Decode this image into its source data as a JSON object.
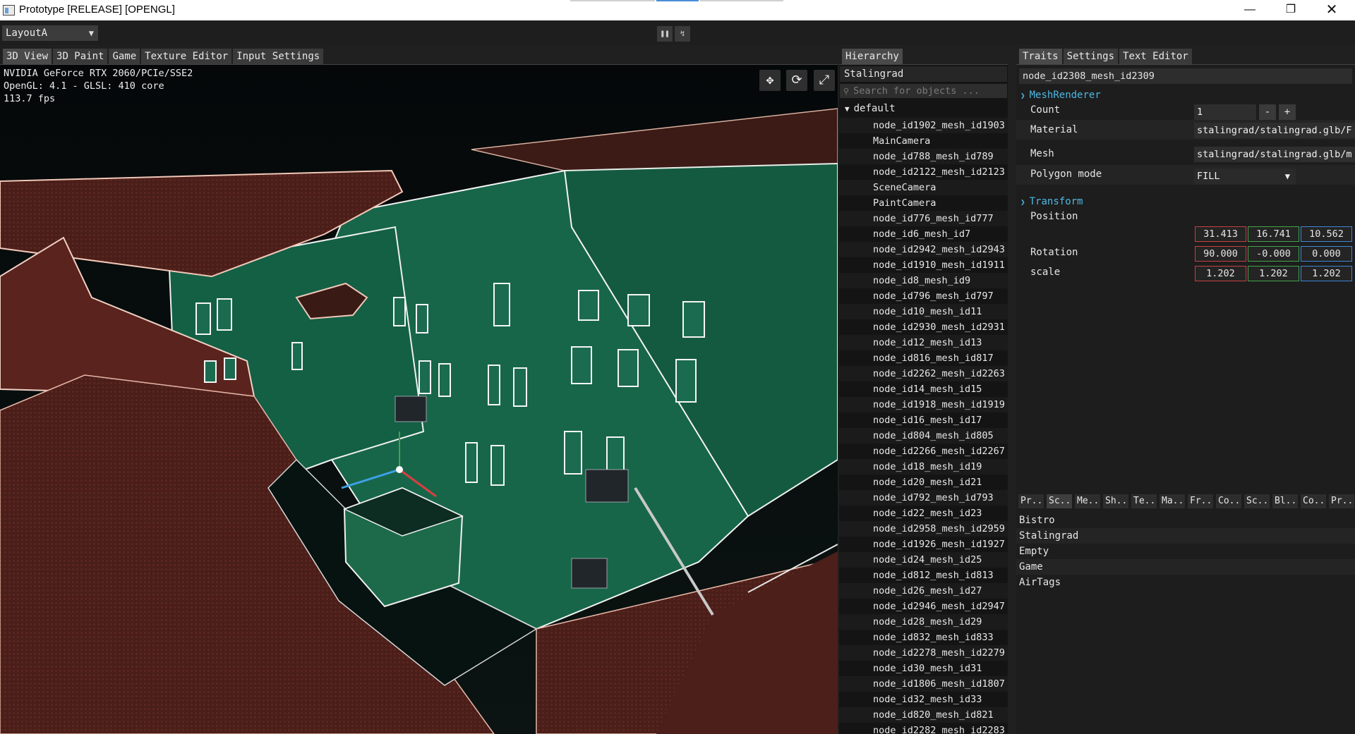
{
  "window": {
    "title": "Prototype [RELEASE] [OPENGL]",
    "minimize_icon": "minimize-icon",
    "maximize_icon": "restore-icon",
    "close_icon": "close-icon"
  },
  "toolbar": {
    "layout_value": "LayoutA",
    "pause_icon": "pause-icon",
    "step_icon": "step-icon"
  },
  "viewport_tabs": [
    "3D View",
    "3D Paint",
    "Game",
    "Texture Editor",
    "Input Settings"
  ],
  "viewport": {
    "gpu": "NVIDIA GeForce RTX 2060/PCIe/SSE2",
    "opengl": "OpenGL: 4.1 - GLSL: 410 core",
    "fps": "113.7 fps",
    "buttons": [
      "move-icon",
      "rotate-icon",
      "scale-icon"
    ]
  },
  "hierarchy": {
    "tab": "Hierarchy",
    "scene_name": "Stalingrad",
    "search_placeholder": "Search for objects ...",
    "group": "default",
    "items": [
      "node_id1902_mesh_id1903",
      "MainCamera",
      "node_id788_mesh_id789",
      "node_id2122_mesh_id2123",
      "SceneCamera",
      "PaintCamera",
      "node_id776_mesh_id777",
      "node_id6_mesh_id7",
      "node_id2942_mesh_id2943",
      "node_id1910_mesh_id1911",
      "node_id8_mesh_id9",
      "node_id796_mesh_id797",
      "node_id10_mesh_id11",
      "node_id2930_mesh_id2931",
      "node_id12_mesh_id13",
      "node_id816_mesh_id817",
      "node_id2262_mesh_id2263",
      "node_id14_mesh_id15",
      "node_id1918_mesh_id1919",
      "node_id16_mesh_id17",
      "node_id804_mesh_id805",
      "node_id2266_mesh_id2267",
      "node_id18_mesh_id19",
      "node_id20_mesh_id21",
      "node_id792_mesh_id793",
      "node_id22_mesh_id23",
      "node_id2958_mesh_id2959",
      "node_id1926_mesh_id1927",
      "node_id24_mesh_id25",
      "node_id812_mesh_id813",
      "node_id26_mesh_id27",
      "node_id2946_mesh_id2947",
      "node_id28_mesh_id29",
      "node_id832_mesh_id833",
      "node_id2278_mesh_id2279",
      "node_id30_mesh_id31",
      "node_id1806_mesh_id1807",
      "node_id32_mesh_id33",
      "node_id820_mesh_id821",
      "node_id2282_mesh_id2283"
    ]
  },
  "inspector": {
    "tabs": [
      "Traits",
      "Settings",
      "Text Editor"
    ],
    "node_name": "node_id2308_mesh_id2309",
    "mesh_renderer": {
      "title": "MeshRenderer",
      "count_label": "Count",
      "count_value": "1",
      "minus": "-",
      "plus": "+",
      "material_label": "Material",
      "material_value": "stalingrad/stalingrad.glb/F",
      "mesh_label": "Mesh",
      "mesh_value": "stalingrad/stalingrad.glb/m",
      "polygon_label": "Polygon mode",
      "polygon_value": "FILL"
    },
    "transform": {
      "title": "Transform",
      "position_label": "Position",
      "position": [
        "31.413",
        "16.741",
        "10.562"
      ],
      "rotation_label": "Rotation",
      "rotation": [
        "90.000",
        "-0.000",
        "0.000"
      ],
      "scale_label": "scale",
      "scale": [
        "1.202",
        "1.202",
        "1.202"
      ]
    },
    "scene_tabs": [
      "Pr...",
      "Sc...",
      "Me...",
      "Sh...",
      "Te...",
      "Ma...",
      "Fr...",
      "Co...",
      "Sc...",
      "Bl...",
      "Co...",
      "Pr..."
    ],
    "scenes": [
      "Bistro",
      "Stalingrad",
      "Empty",
      "Game",
      "AirTags"
    ]
  },
  "colors": {
    "axis_x": "#c64040",
    "axis_y": "#43a24a",
    "axis_z": "#3f86d6",
    "section_accent": "#4cb8e6"
  }
}
